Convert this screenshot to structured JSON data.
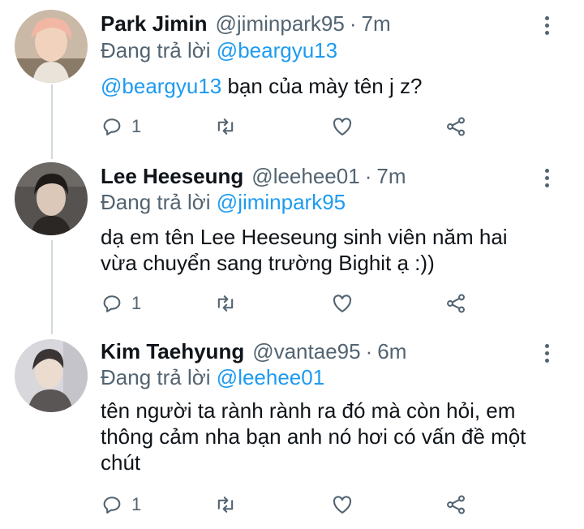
{
  "tweets": [
    {
      "name": "Park Jimin",
      "handle": "@jiminpark95",
      "separator": "·",
      "time": "7m",
      "replying_label": "Đang trả lời",
      "replying_to": "@beargyu13",
      "body_mention": "@beargyu13",
      "body_text": " bạn của mày tên j z?",
      "reply_count": "1",
      "avatar_icon": "avatar-photo"
    },
    {
      "name": "Lee Heeseung",
      "handle": "@leehee01",
      "separator": "·",
      "time": "7m",
      "replying_label": "Đang trả lời",
      "replying_to": "@jiminpark95",
      "body_lines": [
        "dạ em tên Lee Heeseung sinh viên năm hai",
        "vừa chuyển sang trường Bighit ạ :))"
      ],
      "reply_count": "1",
      "avatar_icon": "avatar-photo"
    },
    {
      "name": "Kim Taehyung",
      "handle": "@vantae95",
      "separator": "·",
      "time": "6m",
      "replying_label": "Đang trả lời",
      "replying_to": "@leehee01",
      "body_lines": [
        "tên người ta rành rành ra đó mà còn hỏi, em",
        "thông cảm nha bạn anh nó hơi có vấn đề một",
        "chút"
      ],
      "reply_count": "1",
      "avatar_icon": "avatar-photo"
    }
  ],
  "icons": [
    "reply-icon",
    "retweet-icon",
    "like-icon",
    "share-icon",
    "more-icon"
  ],
  "colors": {
    "accent": "#1d9bf0",
    "muted": "#536471",
    "text": "#0f1419",
    "thread": "#cfd9de"
  }
}
